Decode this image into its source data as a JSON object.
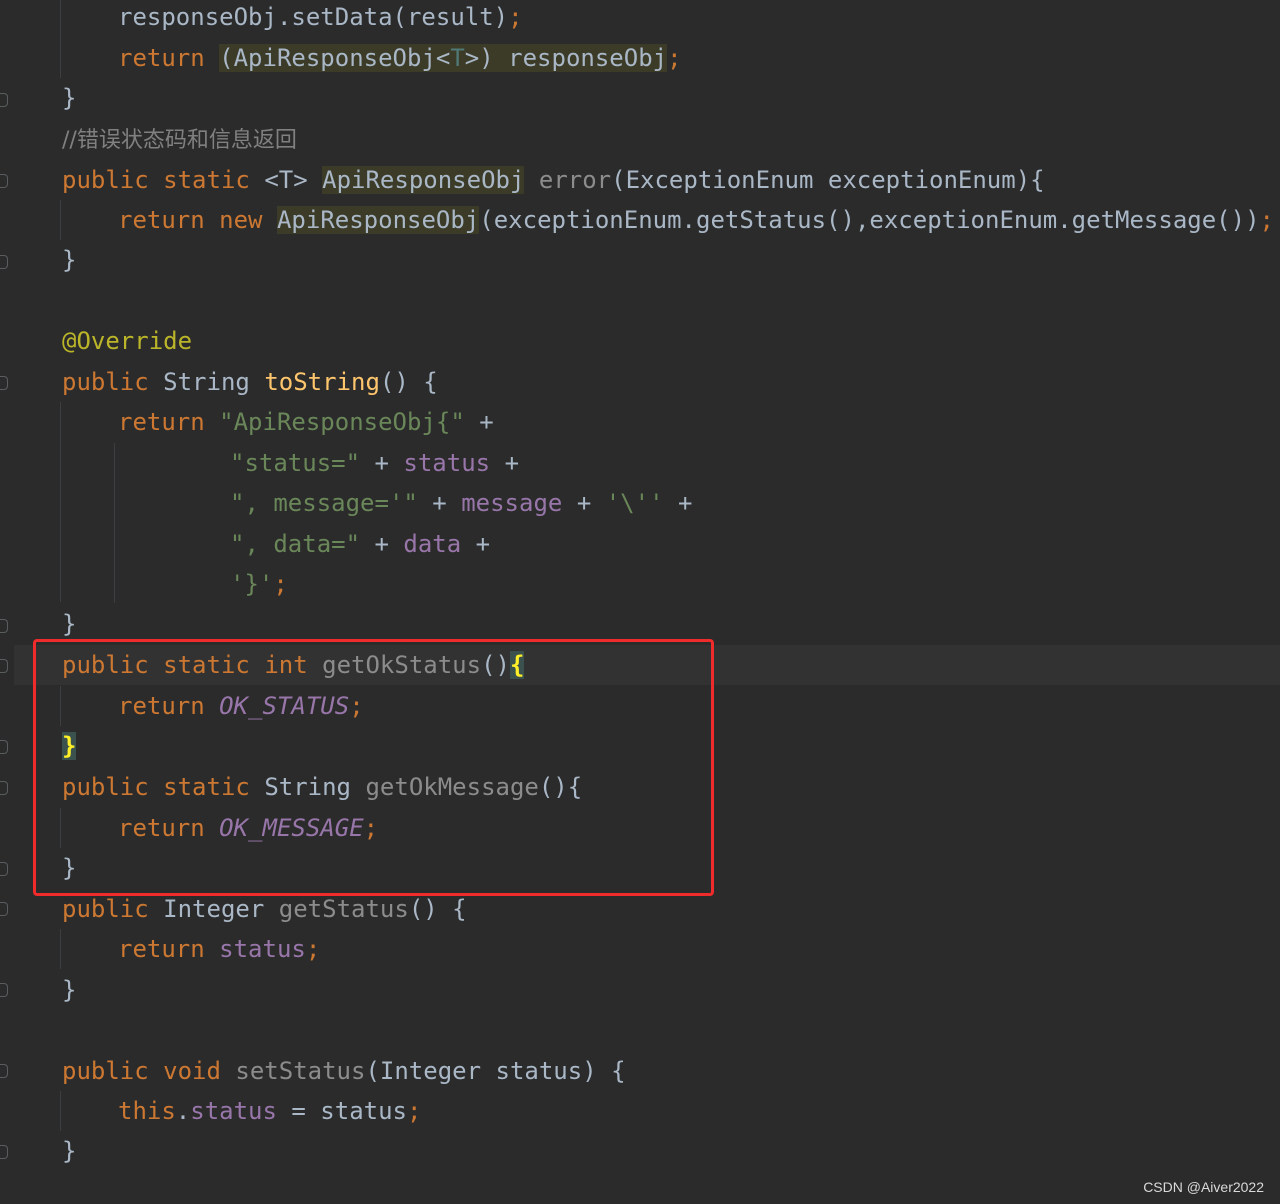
{
  "code": {
    "l1_text": "responseObj.setData(result)",
    "l1_semi": ";",
    "l2_return": "return",
    "l2_cast_open": "(ApiResponseObj<",
    "l2_cast_T": "T",
    "l2_cast_close": ">) responseObj",
    "l2_semi": ";",
    "brace": "}",
    "comment": "//错误状态码和信息返回",
    "kw_public": "public",
    "kw_static": "static",
    "kw_return": "return",
    "kw_new": "new",
    "kw_int": "int",
    "kw_void": "void",
    "kw_this": "this",
    "generic_T": "<T>",
    "type_api": "ApiResponseObj",
    "m_error": "error",
    "error_params": "(ExceptionEnum exceptionEnum){",
    "new_args": "(exceptionEnum.getStatus(),exceptionEnum.getMessage())",
    "semi": ";",
    "annotation": "@Override",
    "type_string": "String",
    "m_tostring": "toString",
    "tostring_tail": "() {",
    "str1": "\"ApiResponseObj{\"",
    "str2": "\"status=\"",
    "str3": "\", message='\"",
    "str4": "'\\''",
    "str5": "\", data=\"",
    "str6": "'}'",
    "plus": "+",
    "f_status": "status",
    "f_message": "message",
    "f_data": "data",
    "m_getokstatus": "getOkStatus",
    "paren_open": "()",
    "open_brace": "{",
    "c_ok_status": "OK_STATUS",
    "m_getokmessage": "getOkMessage",
    "paren_brace": "(){",
    "c_ok_message": "OK_MESSAGE",
    "type_integer": "Integer",
    "m_getstatus": "getStatus",
    "paren_space_brace": "() {",
    "m_setstatus": "setStatus",
    "setstatus_params": "(Integer status) {",
    "dot": ".",
    "assign_rhs": " = status"
  },
  "watermark": "CSDN @Aiver2022",
  "colors": {
    "background": "#2b2b2b",
    "keyword": "#cc7832",
    "method": "#ffc66d",
    "string": "#6a8759",
    "field": "#9876aa",
    "comment": "#808080",
    "annotation": "#bbb529",
    "highlight_box": "#f02b2b"
  }
}
